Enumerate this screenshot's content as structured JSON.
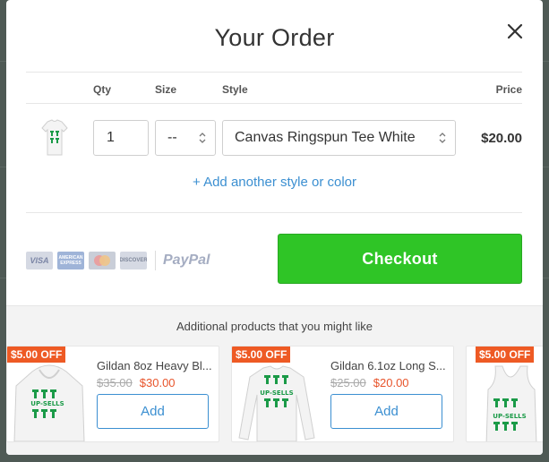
{
  "modal": {
    "title": "Your Order",
    "close_icon": "close-icon"
  },
  "order_table": {
    "headers": {
      "qty": "Qty",
      "size": "Size",
      "style": "Style",
      "price": "Price"
    },
    "row": {
      "thumbnail_icon": "tshirt-thumbnail",
      "qty": "1",
      "size": "--",
      "style": "Canvas Ringspun Tee White",
      "price": "$20.00"
    },
    "add_style_link": "+ Add another style or color"
  },
  "payment": {
    "cards": [
      {
        "name": "visa-card-icon",
        "label": "VISA"
      },
      {
        "name": "amex-card-icon",
        "label": "AMERICAN EXPRESS"
      },
      {
        "name": "mastercard-card-icon",
        "label": ""
      },
      {
        "name": "discover-card-icon",
        "label": "DISCOVER"
      }
    ],
    "paypal": "PayPal",
    "checkout_label": "Checkout",
    "checkout_color": "#2fc526"
  },
  "upsell": {
    "title": "Additional products that you might like",
    "products": [
      {
        "badge": "$5.00 OFF",
        "name": "Gildan 8oz Heavy Bl...",
        "old_price": "$35.00",
        "new_price": "$30.00",
        "add_label": "Add",
        "image_text": "UP-SELLS"
      },
      {
        "badge": "$5.00 OFF",
        "name": "Gildan 6.1oz Long S...",
        "old_price": "$25.00",
        "new_price": "$20.00",
        "add_label": "Add",
        "image_text": "UP-SELLS"
      },
      {
        "badge": "$5.00 OFF",
        "image_text": "UP-SELLS"
      }
    ],
    "badge_color": "#ee5a24",
    "link_color": "#3b8fd1"
  }
}
